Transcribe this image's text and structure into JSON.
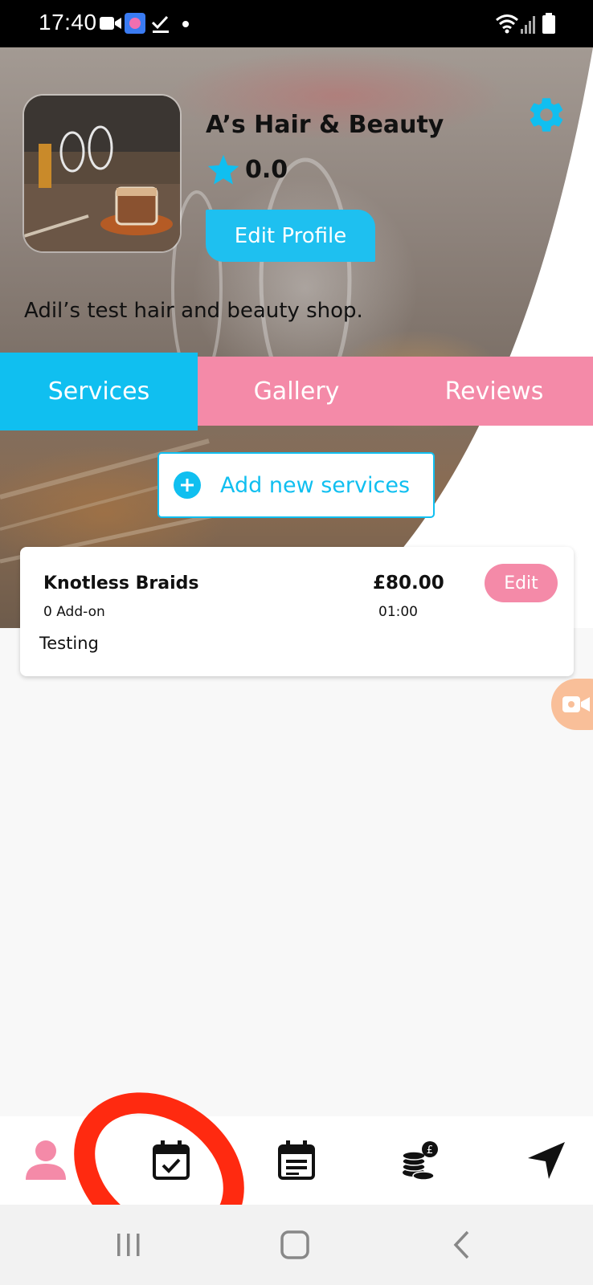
{
  "status_bar": {
    "time": "17:40",
    "icons": [
      "video-icon",
      "app-icon",
      "check-icon",
      "dot-icon",
      "wifi-icon",
      "signal-icon",
      "battery-icon"
    ]
  },
  "profile": {
    "shop_name": "A’s Hair & Beauty",
    "rating": "0.0",
    "edit_profile_label": "Edit Profile",
    "description": "Adil’s test hair and beauty shop."
  },
  "tabs": [
    {
      "label": "Services",
      "active": true
    },
    {
      "label": "Gallery",
      "active": false
    },
    {
      "label": "Reviews",
      "active": false
    }
  ],
  "add_services_label": "Add new services",
  "services": [
    {
      "name": "Knotless Braids",
      "price": "£80.00",
      "addons": "0 Add-on",
      "duration": "01:00",
      "description": "Testing",
      "edit_label": "Edit"
    }
  ],
  "bottom_nav": [
    {
      "icon": "profile-icon",
      "active": true
    },
    {
      "icon": "calendar-check-icon",
      "active": false
    },
    {
      "icon": "calendar-list-icon",
      "active": false
    },
    {
      "icon": "coins-pound-icon",
      "active": false
    },
    {
      "icon": "navigation-arrow-icon",
      "active": false
    }
  ],
  "colors": {
    "accent_blue": "#10bff0",
    "accent_pink": "#f48aa8",
    "annotation_red": "#ff2a10"
  }
}
